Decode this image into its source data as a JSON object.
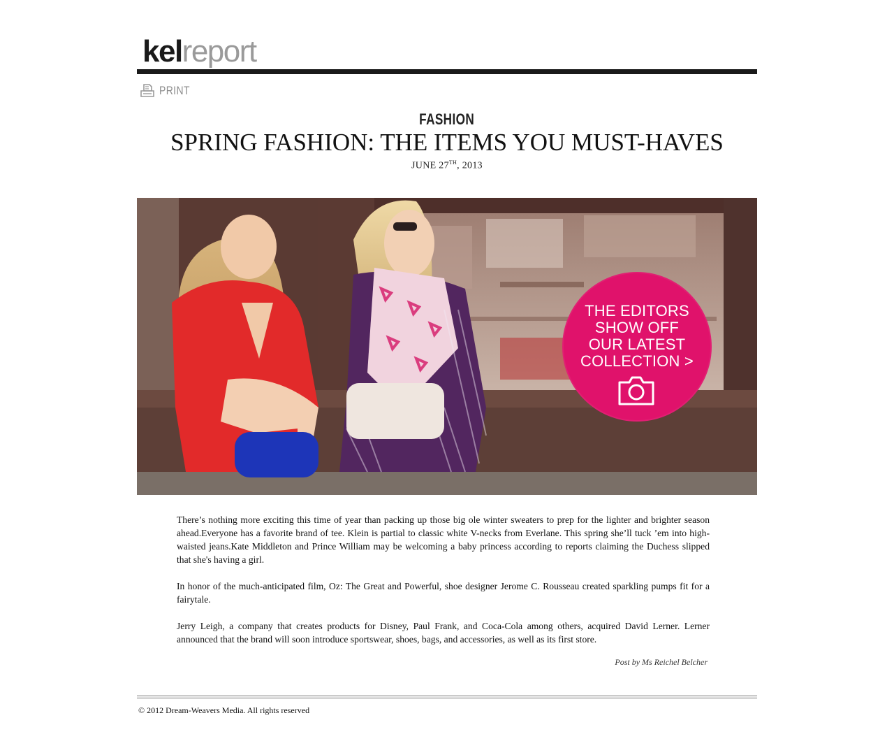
{
  "brand": {
    "part1": "kel",
    "part2": "report"
  },
  "print": {
    "label": "PRINT",
    "icon": "printer-icon"
  },
  "article": {
    "category": "FASHION",
    "title": "SPRING FASHION: THE ITEMS YOU MUST-HAVES",
    "date": {
      "month_day": "JUNE 27",
      "suffix": "TH",
      "year": ", 2013"
    },
    "hero_promo": {
      "lines": [
        "THE EDITORS",
        "SHOW OFF",
        "OUR LATEST",
        "COLLECTION >"
      ],
      "icon": "camera-icon",
      "color": "#e0126b"
    },
    "paragraphs": [
      "There’s nothing more exciting this time of year than packing up those big ole winter sweaters to prep for the lighter and brighter season ahead.Everyone has a favorite brand of tee. Klein is partial to classic white V-necks from Everlane. This spring she’ll tuck ’em into high-waisted jeans.Kate Middleton and Prince William may be welcoming a baby princess according to reports claiming the Duchess slipped that she's having a girl.",
      "In honor of the much-anticipated film, Oz: The Great and Powerful, shoe designer Jerome C. Rousseau created sparkling pumps fit for a fairytale.",
      "Jerry Leigh, a company that creates products for Disney, Paul Frank, and Coca-Cola among others, acquired David Lerner. Lerner announced that the brand will soon introduce sportswear, shoes, bags, and accessories, as well as its first store."
    ],
    "byline": "Post by Ms Reichel Belcher"
  },
  "footer": {
    "copyright": "© 2012 Dream-Weavers Media. All rights reserved"
  }
}
